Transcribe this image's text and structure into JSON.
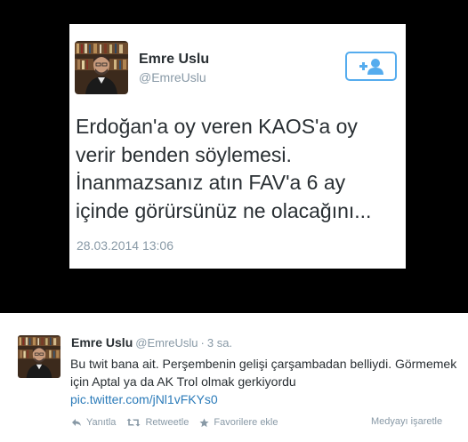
{
  "embedded_tweet": {
    "author_name": "Emre Uslu",
    "author_handle": "@EmreUslu",
    "text": "Erdoğan'a oy veren KAOS'a oy verir benden söylemesi. İnanmazsanız atın FAV'a 6 ay içinde görürsünüz ne olacağını...",
    "timestamp": "28.03.2014 13:06",
    "follow_icon": "add-user-icon"
  },
  "tweet": {
    "author_name": "Emre Uslu",
    "author_handle": "@EmreUslu",
    "separator": "·",
    "time_ago": "3 sa.",
    "text": "Bu twit bana ait. Perşembenin gelişi çarşambadan belliydi. Görmemek için Aptal ya da AK Trol olmak gerkiyordu",
    "link": "pic.twitter.com/jNl1vFKYs0",
    "actions": {
      "reply_label": "Yanıtla",
      "retweet_label": "Retweetle",
      "favorite_label": "Favorilere ekle"
    },
    "flag_media_label": "Medyayı işaretle"
  },
  "colors": {
    "media_background": "#000000",
    "link": "#2b7bb9",
    "accent": "#55acee",
    "muted": "#8899a6",
    "text": "#292f33"
  }
}
